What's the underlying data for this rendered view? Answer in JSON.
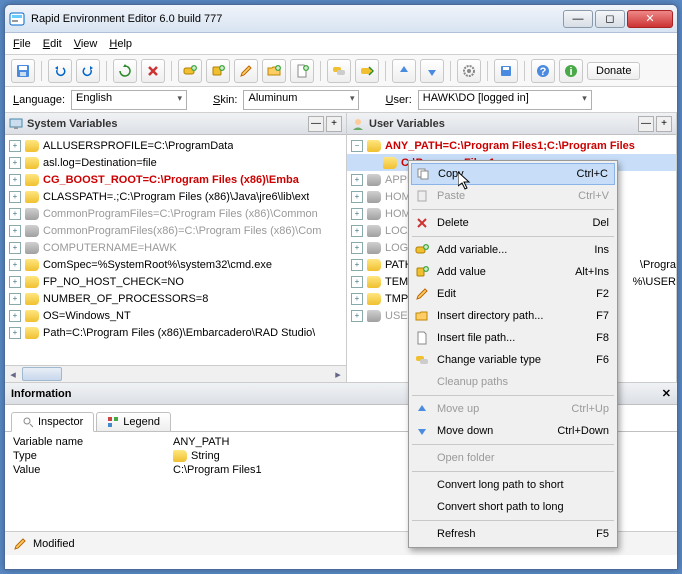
{
  "title": "Rapid Environment Editor 6.0 build 777",
  "menu": [
    "File",
    "Edit",
    "View",
    "Help"
  ],
  "opt": {
    "lang_lbl": "Language:",
    "lang_val": "English",
    "skin_lbl": "Skin:",
    "skin_val": "Aluminum",
    "user_lbl": "User:",
    "user_val": "HAWK\\DO [logged in]"
  },
  "donate": "Donate",
  "panel_sys": "System Variables",
  "panel_usr": "User Variables",
  "sys": [
    {
      "t": "ALLUSERSPROFILE=C:\\ProgramData",
      "c": "y"
    },
    {
      "t": "asl.log=Destination=file",
      "c": "y"
    },
    {
      "t": "CG_BOOST_ROOT=C:\\Program Files (x86)\\Emba",
      "c": "y",
      "err": true
    },
    {
      "t": "CLASSPATH=.;C:\\Program Files (x86)\\Java\\jre6\\lib\\ext",
      "c": "y"
    },
    {
      "t": "CommonProgramFiles=C:\\Program Files (x86)\\Common",
      "c": "g",
      "grey": true
    },
    {
      "t": "CommonProgramFiles(x86)=C:\\Program Files (x86)\\Com",
      "c": "g",
      "grey": true
    },
    {
      "t": "COMPUTERNAME=HAWK",
      "c": "g",
      "grey": true
    },
    {
      "t": "ComSpec=%SystemRoot%\\system32\\cmd.exe",
      "c": "y"
    },
    {
      "t": "FP_NO_HOST_CHECK=NO",
      "c": "y"
    },
    {
      "t": "NUMBER_OF_PROCESSORS=8",
      "c": "y"
    },
    {
      "t": "OS=Windows_NT",
      "c": "y"
    },
    {
      "t": "Path=C:\\Program Files (x86)\\Embarcadero\\RAD Studio\\",
      "c": "y"
    }
  ],
  "usr_top": {
    "t": "ANY_PATH=C:\\Program Files1;C:\\Program Files",
    "c": "y"
  },
  "usr_sel": {
    "t": "C:\\Program Files1"
  },
  "usr": [
    {
      "t": "APPD",
      "c": "g"
    },
    {
      "t": "HOM",
      "c": "g"
    },
    {
      "t": "HOM",
      "c": "g"
    },
    {
      "t": "LOCA",
      "c": "g"
    },
    {
      "t": "LOGO",
      "c": "g"
    },
    {
      "t": "PATH",
      "c": "y",
      "tail": "\\Progra"
    },
    {
      "t": "TEMP",
      "c": "y",
      "tail": "%\\USER"
    },
    {
      "t": "TMP=",
      "c": "y"
    },
    {
      "t": "USER",
      "c": "g"
    }
  ],
  "info_hdr": "Information",
  "tabs": {
    "inspector": "Inspector",
    "legend": "Legend"
  },
  "inspect": {
    "k1": "Variable name",
    "v1": "ANY_PATH",
    "k2": "Type",
    "v2": "String",
    "k3": "Value",
    "v3": "C:\\Program Files1"
  },
  "status": "Modified",
  "ctx": [
    {
      "lbl": "Copy",
      "sc": "Ctrl+C",
      "ico": "copy",
      "hl": true
    },
    {
      "lbl": "Paste",
      "sc": "Ctrl+V",
      "ico": "paste",
      "dis": true
    },
    {
      "sep": true
    },
    {
      "lbl": "Delete",
      "sc": "Del",
      "ico": "del"
    },
    {
      "sep": true
    },
    {
      "lbl": "Add variable...",
      "sc": "Ins",
      "ico": "addvar"
    },
    {
      "lbl": "Add value",
      "sc": "Alt+Ins",
      "ico": "addval"
    },
    {
      "lbl": "Edit",
      "sc": "F2",
      "ico": "edit"
    },
    {
      "lbl": "Insert directory path...",
      "sc": "F7",
      "ico": "dir"
    },
    {
      "lbl": "Insert file path...",
      "sc": "F8",
      "ico": "file"
    },
    {
      "lbl": "Change variable type",
      "sc": "F6",
      "ico": "type"
    },
    {
      "lbl": "Cleanup paths",
      "dis": true
    },
    {
      "sep": true
    },
    {
      "lbl": "Move up",
      "sc": "Ctrl+Up",
      "ico": "up",
      "dis": true
    },
    {
      "lbl": "Move down",
      "sc": "Ctrl+Down",
      "ico": "down"
    },
    {
      "sep": true
    },
    {
      "lbl": "Open folder",
      "dis": true
    },
    {
      "sep": true
    },
    {
      "lbl": "Convert long path to short"
    },
    {
      "lbl": "Convert short path to long"
    },
    {
      "sep": true
    },
    {
      "lbl": "Refresh",
      "sc": "F5"
    }
  ]
}
